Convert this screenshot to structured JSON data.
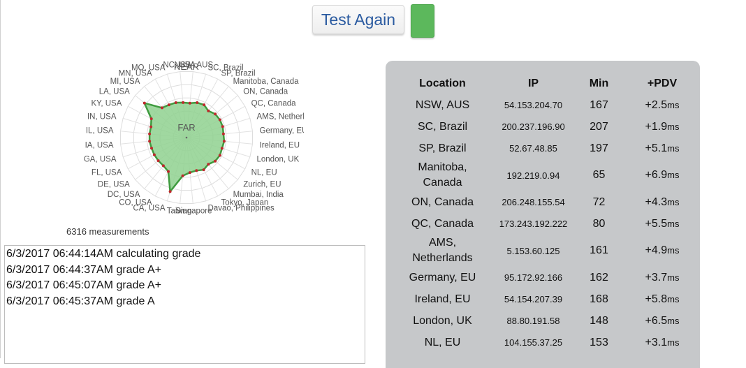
{
  "header": {
    "test_again_label": "Test Again",
    "status_color": "#5cb85c"
  },
  "radar": {
    "center_label": "FAR",
    "outer_label": "NEAR",
    "fill_color": "#8fd18f",
    "line_color": "#3f9b3f",
    "point_color": "#c0282d",
    "axes": [
      "NSW, AUS",
      "SC, Brazil",
      "SP, Brazil",
      "Manitoba, Canada",
      "ON, Canada",
      "QC, Canada",
      "AMS, Netherlands",
      "Germany, EU",
      "Ireland, EU",
      "London, UK",
      "NL, EU",
      "Zurich, EU",
      "Mumbai, India",
      "Tokyo, Japan",
      "Davao, Philippines",
      "Singapore",
      "Taiwan",
      "CA, USA",
      "CO, USA",
      "DC, USA",
      "DE, USA",
      "FL, USA",
      "GA, USA",
      "IA, USA",
      "IL, USA",
      "IN, USA",
      "KY, USA",
      "LA, USA",
      "MI, USA",
      "MN, USA",
      "MO, USA",
      "NC, USA"
    ],
    "values": [
      0.52,
      0.55,
      0.56,
      0.52,
      0.56,
      0.57,
      0.57,
      0.56,
      0.57,
      0.56,
      0.57,
      0.56,
      0.52,
      0.55,
      0.52,
      0.53,
      0.58,
      0.85,
      0.58,
      0.55,
      0.55,
      0.55,
      0.55,
      0.56,
      0.56,
      0.56,
      0.6,
      0.82,
      0.58,
      0.56,
      0.55,
      0.53
    ]
  },
  "measurements_text": "6316 measurements",
  "log": {
    "lines": [
      "6/3/2017 06:44:14AM calculating grade",
      "6/3/2017 06:44:37AM grade A+",
      "6/3/2017 06:45:07AM grade A+",
      "6/3/2017 06:45:37AM grade A"
    ]
  },
  "table": {
    "headers": [
      "Location",
      "IP",
      "Min",
      "+PDV"
    ],
    "unit": "ms",
    "rows": [
      {
        "location": [
          "NSW, AUS"
        ],
        "ip": "54.153.204.70",
        "min": "167",
        "pdv": "+2.5"
      },
      {
        "location": [
          "SC, Brazil"
        ],
        "ip": "200.237.196.90",
        "min": "207",
        "pdv": "+1.9"
      },
      {
        "location": [
          "SP, Brazil"
        ],
        "ip": "52.67.48.85",
        "min": "197",
        "pdv": "+5.1"
      },
      {
        "location": [
          "Manitoba,",
          "Canada"
        ],
        "ip": "192.219.0.94",
        "min": "65",
        "pdv": "+6.9"
      },
      {
        "location": [
          "ON, Canada"
        ],
        "ip": "206.248.155.54",
        "min": "72",
        "pdv": "+4.3"
      },
      {
        "location": [
          "QC, Canada"
        ],
        "ip": "173.243.192.222",
        "min": "80",
        "pdv": "+5.5"
      },
      {
        "location": [
          "AMS,",
          "Netherlands"
        ],
        "ip": "5.153.60.125",
        "min": "161",
        "pdv": "+4.9"
      },
      {
        "location": [
          "Germany, EU"
        ],
        "ip": "95.172.92.166",
        "min": "162",
        "pdv": "+3.7"
      },
      {
        "location": [
          "Ireland, EU"
        ],
        "ip": "54.154.207.39",
        "min": "168",
        "pdv": "+5.8"
      },
      {
        "location": [
          "London, UK"
        ],
        "ip": "88.80.191.58",
        "min": "148",
        "pdv": "+6.5"
      },
      {
        "location": [
          "NL, EU"
        ],
        "ip": "104.155.37.25",
        "min": "153",
        "pdv": "+3.1"
      }
    ]
  }
}
